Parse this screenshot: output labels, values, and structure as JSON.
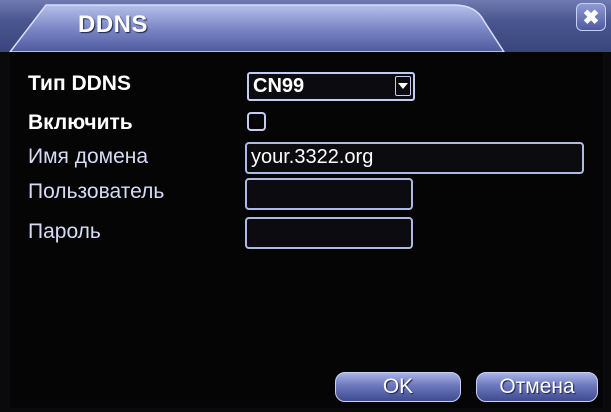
{
  "window": {
    "title": "DDNS",
    "close_symbol": "✖",
    "close_icon": "close-icon"
  },
  "form": {
    "ddns_type": {
      "label": "Тип DDNS",
      "value": "CN99"
    },
    "enable": {
      "label": "Включить",
      "checked": false
    },
    "domain": {
      "label": "Имя домена",
      "value": "your.3322.org"
    },
    "user": {
      "label": "Пользователь",
      "value": ""
    },
    "password": {
      "label": "Пароль",
      "value": ""
    }
  },
  "buttons": {
    "ok": "OK",
    "cancel": "Отмена"
  },
  "colors": {
    "title_bar": "#4a568f",
    "background": "#050506",
    "field_border": "#aeb9e6",
    "text": "#ffffff"
  }
}
